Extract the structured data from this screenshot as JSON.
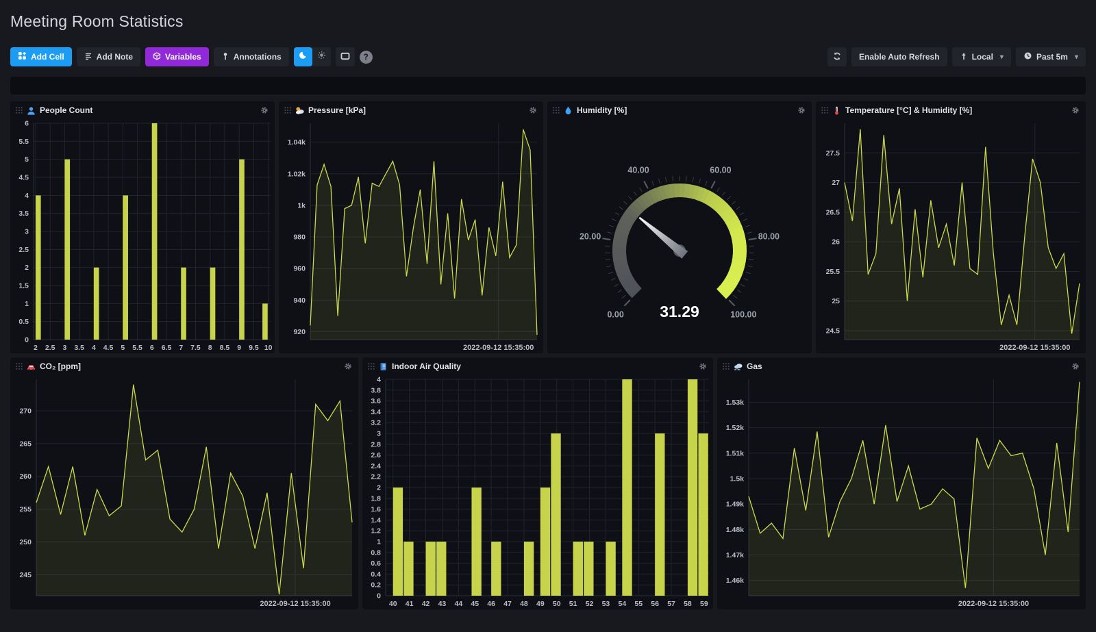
{
  "page": {
    "title": "Meeting Room Statistics"
  },
  "toolbar": {
    "add_cell": "Add Cell",
    "add_note": "Add Note",
    "variables": "Variables",
    "annotations": "Annotations",
    "enable_auto_refresh": "Enable Auto Refresh",
    "timezone": "Local",
    "time_range": "Past 5m",
    "help_label": "?"
  },
  "colors": {
    "background": "#17191f",
    "panel": "#0e1016",
    "series": "#cdd94b",
    "accent_blue": "#1c9cf2",
    "accent_purple": "#9129d9",
    "gauge_low": "#4f515a",
    "gauge_high": "#d8ee4e"
  },
  "chart_data": [
    {
      "id": "people-count",
      "title": "People Count",
      "icon": "people-icon",
      "type": "bar",
      "x": [
        2,
        3,
        4,
        5,
        6,
        7,
        8,
        9,
        9.8
      ],
      "values": [
        4,
        5,
        2,
        4,
        6,
        2,
        2,
        5,
        1
      ],
      "bar_width": 0.18,
      "xlim": [
        1.93,
        10.08
      ],
      "ylim": [
        0,
        6
      ],
      "margin_left": 34,
      "grid": "both",
      "yticks": [
        {
          "v": 0,
          "t": "0"
        },
        {
          "v": 0.5,
          "t": "0.5"
        },
        {
          "v": 1,
          "t": "1"
        },
        {
          "v": 1.5,
          "t": "1.5"
        },
        {
          "v": 2,
          "t": "2"
        },
        {
          "v": 2.5,
          "t": "2.5"
        },
        {
          "v": 3,
          "t": "3"
        },
        {
          "v": 3.5,
          "t": "3.5"
        },
        {
          "v": 4,
          "t": "4"
        },
        {
          "v": 4.5,
          "t": "4.5"
        },
        {
          "v": 5,
          "t": "5"
        },
        {
          "v": 5.5,
          "t": "5.5"
        },
        {
          "v": 6,
          "t": "6"
        }
      ],
      "xticks": [
        {
          "v": 2,
          "t": "2"
        },
        {
          "v": 2.5,
          "t": "2.5"
        },
        {
          "v": 3,
          "t": "3"
        },
        {
          "v": 3.5,
          "t": "3.5"
        },
        {
          "v": 4,
          "t": "4"
        },
        {
          "v": 4.5,
          "t": "4.5"
        },
        {
          "v": 5,
          "t": "5"
        },
        {
          "v": 5.5,
          "t": "5.5"
        },
        {
          "v": 6,
          "t": "6"
        },
        {
          "v": 6.5,
          "t": "6.5"
        },
        {
          "v": 7,
          "t": "7"
        },
        {
          "v": 7.5,
          "t": "7.5"
        },
        {
          "v": 8,
          "t": "8"
        },
        {
          "v": 8.5,
          "t": "8.5"
        },
        {
          "v": 9,
          "t": "9"
        },
        {
          "v": 9.5,
          "t": "9.5"
        },
        {
          "v": 10,
          "t": "10"
        }
      ]
    },
    {
      "id": "pressure",
      "title": "Pressure [kPa]",
      "icon": "pressure-icon",
      "type": "area",
      "values": [
        924,
        1013,
        1026,
        1012,
        930,
        998,
        1000,
        1018,
        976,
        1014,
        1012,
        1020,
        1028,
        1013,
        955,
        986,
        1010,
        963,
        1028,
        950,
        995,
        941,
        1004,
        978,
        991,
        943,
        986,
        968,
        1015,
        967,
        975,
        1048,
        1035,
        918
      ],
      "ylim": [
        915,
        1052
      ],
      "margin_left": 46,
      "vline_frac": 0.83,
      "yticks": [
        {
          "v": 1040,
          "t": "1.04k"
        },
        {
          "v": 1020,
          "t": "1.02k"
        },
        {
          "v": 1000,
          "t": "1k"
        },
        {
          "v": 980,
          "t": "980"
        },
        {
          "v": 960,
          "t": "960"
        },
        {
          "v": 940,
          "t": "940"
        },
        {
          "v": 920,
          "t": "920"
        }
      ],
      "timestamp": "2022-09-12 15:35:00"
    },
    {
      "id": "humidity",
      "title": "Humidity [%]",
      "icon": "humidity-icon",
      "type": "gauge",
      "value": 31.29,
      "display": "31.29",
      "min": 0,
      "max": 100,
      "arc_degrees": 270,
      "labels": [
        {
          "v": 0,
          "t": "0.00"
        },
        {
          "v": 20,
          "t": "20.00"
        },
        {
          "v": 40,
          "t": "40.00"
        },
        {
          "v": 60,
          "t": "60.00"
        },
        {
          "v": 80,
          "t": "80.00"
        },
        {
          "v": 100,
          "t": "100.00"
        }
      ]
    },
    {
      "id": "temperature",
      "title": "Temperature [°C] & Humidity [%]",
      "icon": "temperature-icon",
      "type": "area",
      "values": [
        27.0,
        26.35,
        27.9,
        25.45,
        25.8,
        27.8,
        26.3,
        26.9,
        25.0,
        26.55,
        25.4,
        26.7,
        25.9,
        26.3,
        25.6,
        27.0,
        25.55,
        25.45,
        27.6,
        25.8,
        24.6,
        25.1,
        24.6,
        26.1,
        27.4,
        27.0,
        25.9,
        25.55,
        25.8,
        24.45,
        25.3
      ],
      "ylim": [
        24.35,
        28.0
      ],
      "margin_left": 42,
      "vline_frac": 0.81,
      "yticks": [
        {
          "v": 27.5,
          "t": "27.5"
        },
        {
          "v": 27,
          "t": "27"
        },
        {
          "v": 26.5,
          "t": "26.5"
        },
        {
          "v": 26,
          "t": "26"
        },
        {
          "v": 25.5,
          "t": "25.5"
        },
        {
          "v": 25,
          "t": "25"
        },
        {
          "v": 24.5,
          "t": "24.5"
        }
      ],
      "timestamp": "2022-09-12 15:35:00"
    },
    {
      "id": "co2",
      "title": "CO₂ [ppm]",
      "icon": "co2-icon",
      "type": "area",
      "values": [
        256,
        261.5,
        254.2,
        261.5,
        251,
        258,
        254,
        255.5,
        274,
        262.5,
        264,
        253.5,
        251.5,
        255,
        264.5,
        249,
        260.5,
        257,
        249,
        257.5,
        242,
        260.5,
        246,
        271,
        268.5,
        271.5,
        253
      ],
      "ylim": [
        241.8,
        274.8
      ],
      "margin_left": 38,
      "vline_frac": 0.82,
      "yticks": [
        {
          "v": 270,
          "t": "270"
        },
        {
          "v": 265,
          "t": "265"
        },
        {
          "v": 260,
          "t": "260"
        },
        {
          "v": 255,
          "t": "255"
        },
        {
          "v": 250,
          "t": "250"
        },
        {
          "v": 245,
          "t": "245"
        }
      ],
      "timestamp": "2022-09-12 15:35:00"
    },
    {
      "id": "indoor-air-quality",
      "title": "Indoor Air Quality",
      "icon": "iaq-icon",
      "type": "bar",
      "x": [
        40,
        40.65,
        42,
        42.65,
        44.8,
        46,
        48,
        49,
        49.65,
        51,
        51.65,
        53,
        54,
        56,
        58,
        58.65
      ],
      "values": [
        2,
        1,
        1,
        1,
        2,
        1,
        1,
        2,
        3,
        1,
        1,
        1,
        4,
        3,
        4,
        3
      ],
      "bar_width": 0.6,
      "xlim": [
        39.55,
        59.3
      ],
      "ylim": [
        0,
        4
      ],
      "margin_left": 34,
      "grid": "both",
      "yticks": [
        {
          "v": 0,
          "t": "0"
        },
        {
          "v": 0.2,
          "t": "0.2"
        },
        {
          "v": 0.4,
          "t": "0.4"
        },
        {
          "v": 0.6,
          "t": "0.6"
        },
        {
          "v": 0.8,
          "t": "0.8"
        },
        {
          "v": 1,
          "t": "1"
        },
        {
          "v": 1.2,
          "t": "1.2"
        },
        {
          "v": 1.4,
          "t": "1.4"
        },
        {
          "v": 1.6,
          "t": "1.6"
        },
        {
          "v": 1.8,
          "t": "1.8"
        },
        {
          "v": 2,
          "t": "2"
        },
        {
          "v": 2.2,
          "t": "2.2"
        },
        {
          "v": 2.4,
          "t": "2.4"
        },
        {
          "v": 2.6,
          "t": "2.6"
        },
        {
          "v": 2.8,
          "t": "2.8"
        },
        {
          "v": 3,
          "t": "3"
        },
        {
          "v": 3.2,
          "t": "3.2"
        },
        {
          "v": 3.4,
          "t": "3.4"
        },
        {
          "v": 3.6,
          "t": "3.6"
        },
        {
          "v": 3.8,
          "t": "3.8"
        },
        {
          "v": 4,
          "t": "4"
        }
      ],
      "xticks": [
        {
          "v": 40,
          "t": "40"
        },
        {
          "v": 41,
          "t": "41"
        },
        {
          "v": 42,
          "t": "42"
        },
        {
          "v": 43,
          "t": "43"
        },
        {
          "v": 44,
          "t": "44"
        },
        {
          "v": 45,
          "t": "45"
        },
        {
          "v": 46,
          "t": "46"
        },
        {
          "v": 47,
          "t": "47"
        },
        {
          "v": 48,
          "t": "48"
        },
        {
          "v": 49,
          "t": "49"
        },
        {
          "v": 50,
          "t": "50"
        },
        {
          "v": 51,
          "t": "51"
        },
        {
          "v": 52,
          "t": "52"
        },
        {
          "v": 53,
          "t": "53"
        },
        {
          "v": 54,
          "t": "54"
        },
        {
          "v": 55,
          "t": "55"
        },
        {
          "v": 56,
          "t": "56"
        },
        {
          "v": 57,
          "t": "57"
        },
        {
          "v": 58,
          "t": "58"
        },
        {
          "v": 59,
          "t": "59"
        }
      ]
    },
    {
      "id": "gas",
      "title": "Gas",
      "icon": "gas-icon",
      "type": "area",
      "values": [
        1493,
        1478.5,
        1482.5,
        1476.5,
        1512,
        1487.5,
        1518.5,
        1477,
        1491,
        1500,
        1515,
        1490,
        1521,
        1491,
        1505,
        1488,
        1490,
        1496,
        1492,
        1457,
        1516,
        1504,
        1515,
        1509,
        1510,
        1496,
        1470,
        1514,
        1479,
        1538
      ],
      "ylim": [
        1454,
        1539
      ],
      "margin_left": 46,
      "vline_frac": 0.74,
      "yticks": [
        {
          "v": 1530,
          "t": "1.53k"
        },
        {
          "v": 1520,
          "t": "1.52k"
        },
        {
          "v": 1510,
          "t": "1.51k"
        },
        {
          "v": 1500,
          "t": "1.5k"
        },
        {
          "v": 1490,
          "t": "1.49k"
        },
        {
          "v": 1480,
          "t": "1.48k"
        },
        {
          "v": 1470,
          "t": "1.47k"
        },
        {
          "v": 1460,
          "t": "1.46k"
        }
      ],
      "timestamp": "2022-09-12 15:35:00"
    }
  ]
}
